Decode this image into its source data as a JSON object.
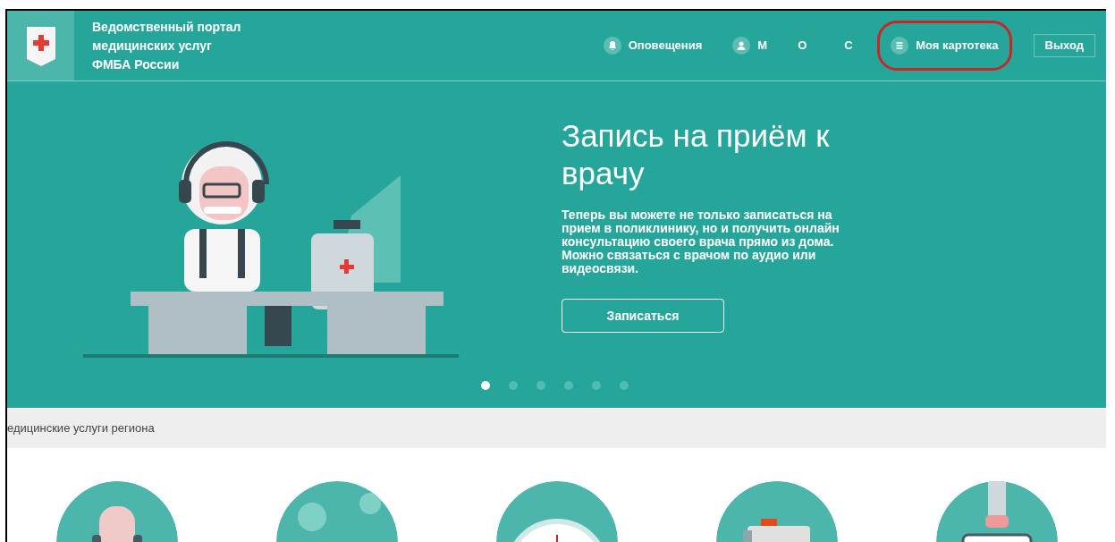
{
  "header": {
    "logo_title": [
      "Ведомственный портал",
      "медицинских услуг",
      "ФМБА России"
    ],
    "nav": [
      {
        "kind": "bell",
        "label": "Оповещения",
        "highlighted": false
      },
      {
        "kind": "user",
        "label": "М",
        "highlighted": false
      },
      {
        "kind": "plain",
        "label": "О",
        "highlighted": false
      },
      {
        "kind": "plain",
        "label": "С",
        "highlighted": false
      },
      {
        "kind": "list",
        "label": "Моя картотека",
        "highlighted": true
      }
    ],
    "logout": "Выход"
  },
  "hero": {
    "title": "Запись на приём к врачу",
    "text": "Теперь вы можете не только записаться на прием в поликлинику, но и получить онлайн консультацию своего врача прямо из дома. Можно связаться с врачом по аудио или видеосвязи.",
    "button": "Записаться",
    "dots": [
      {
        "selected": true
      },
      {
        "selected": false
      },
      {
        "selected": false
      },
      {
        "selected": false
      },
      {
        "selected": false
      },
      {
        "selected": false
      }
    ]
  },
  "services": {
    "title": "едицинские услуги региона",
    "items": [
      {
        "kind": "doctor"
      },
      {
        "kind": "virus"
      },
      {
        "kind": "clock"
      },
      {
        "kind": "folder"
      },
      {
        "kind": "case"
      }
    ]
  }
}
